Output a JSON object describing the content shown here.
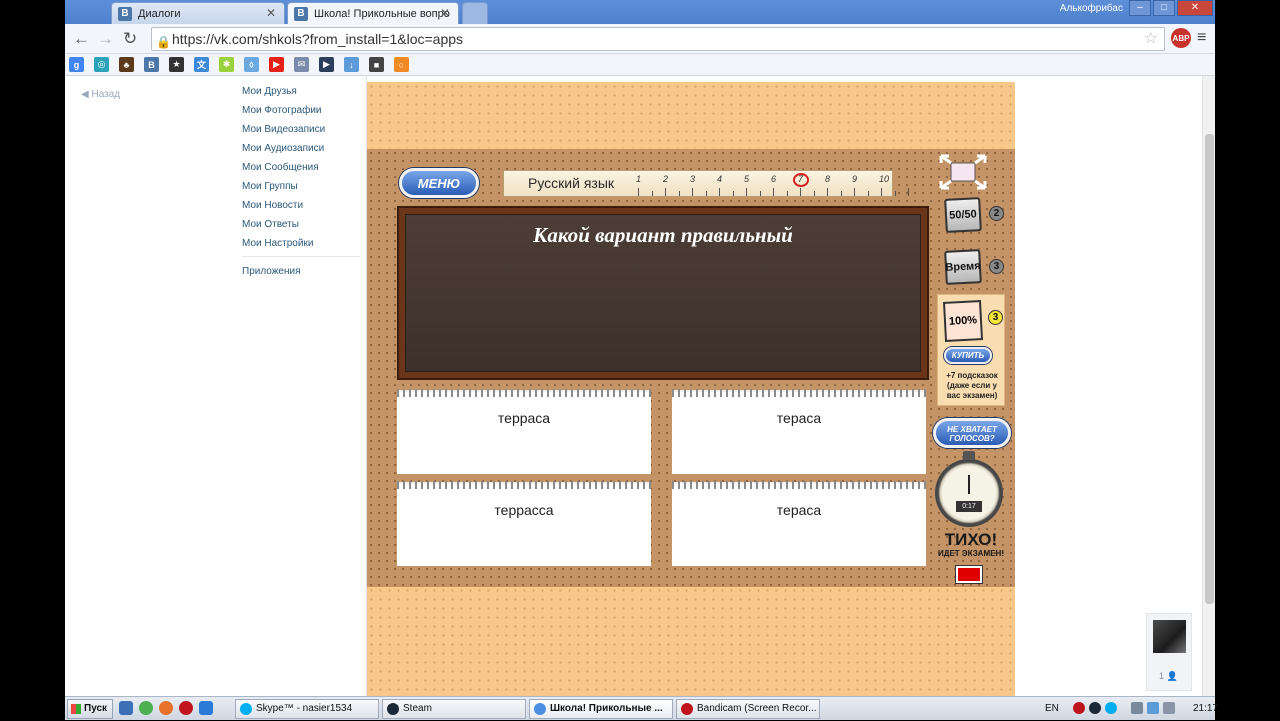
{
  "window": {
    "user_label": "Алькофрибас",
    "buttons": {
      "minimize": "–",
      "maximize": "□",
      "close": "✕"
    }
  },
  "tabs": [
    {
      "label": "Диалоги",
      "favicon": "B",
      "favicon_color": "#4a76a8"
    },
    {
      "label": "Школа! Прикольные вопро",
      "favicon": "B",
      "favicon_color": "#4a76a8"
    }
  ],
  "toolbar": {
    "back_icon": "←",
    "forward_icon": "→",
    "reload_icon": "↻",
    "url": "https://vk.com/shkols?from_install=1&loc=apps",
    "abp_label": "ABP",
    "menu_icon": "≡"
  },
  "bookmarks": [
    {
      "glyph": "g",
      "color": "#4285f4"
    },
    {
      "glyph": "◎",
      "color": "#2aa3b8"
    },
    {
      "glyph": "♣",
      "color": "#5b3a1c"
    },
    {
      "glyph": "B",
      "color": "#4a76a8"
    },
    {
      "glyph": "★",
      "color": "#333333"
    },
    {
      "glyph": "文",
      "color": "#3b89d9"
    },
    {
      "glyph": "✱",
      "color": "#9ad23d"
    },
    {
      "glyph": "◊",
      "color": "#6aa8e0"
    },
    {
      "glyph": "▶",
      "color": "#e62117"
    },
    {
      "glyph": "✉",
      "color": "#7b8bab"
    },
    {
      "glyph": "▶",
      "color": "#2b3f5c"
    },
    {
      "glyph": "↓",
      "color": "#5a9bd8"
    },
    {
      "glyph": "■",
      "color": "#444444"
    },
    {
      "glyph": "○",
      "color": "#f08a24"
    }
  ],
  "sidebar": {
    "back": "◀  Назад",
    "items": [
      "Мои Друзья",
      "Мои Фотографии",
      "Мои Видеозаписи",
      "Мои Аудиозаписи",
      "Мои Сообщения",
      "Мои Группы",
      "Мои Новости",
      "Мои Ответы",
      "Мои Настройки"
    ],
    "apps": "Приложения"
  },
  "game": {
    "menu_label": "МЕНЮ",
    "subject": "Русский язык",
    "progress_numbers": [
      "1",
      "2",
      "3",
      "4",
      "5",
      "6",
      "7",
      "8",
      "9",
      "10"
    ],
    "current_question": 7,
    "question": "Какой вариант правильный",
    "answers": [
      "терраса",
      "тераса",
      "террасса",
      "тераса"
    ],
    "hints": {
      "fifty_label": "50/50",
      "fifty_count": "2",
      "time_label": "Время",
      "time_count": "3",
      "hundred_label": "100%",
      "hundred_count": "3",
      "buy_label": "КУПИТЬ",
      "buy_note": "+7 подсказок (даже если у вас экзамен)"
    },
    "no_votes_label": "НЕ ХВАТАЕТ ГОЛОСОВ?",
    "timer": "0:17",
    "quiet_big": "ТИХО!",
    "quiet_small": "ИДЕТ ЭКЗАМЕН!",
    "indicator_color": "#e00000"
  },
  "friend_widget": {
    "count": "1"
  },
  "taskbar": {
    "start": "Пуск",
    "tasks": [
      {
        "label": "Skype™ - nasier1534",
        "icon_color": "#00aff0"
      },
      {
        "label": "Steam",
        "icon_color": "#1b2838"
      },
      {
        "label": "Школа! Прикольные ...",
        "icon_color": "#4a8fe0"
      },
      {
        "label": "Bandicam (Screen Recor...",
        "icon_color": "#c0141c"
      }
    ],
    "lang": "EN",
    "time": "21:17"
  }
}
